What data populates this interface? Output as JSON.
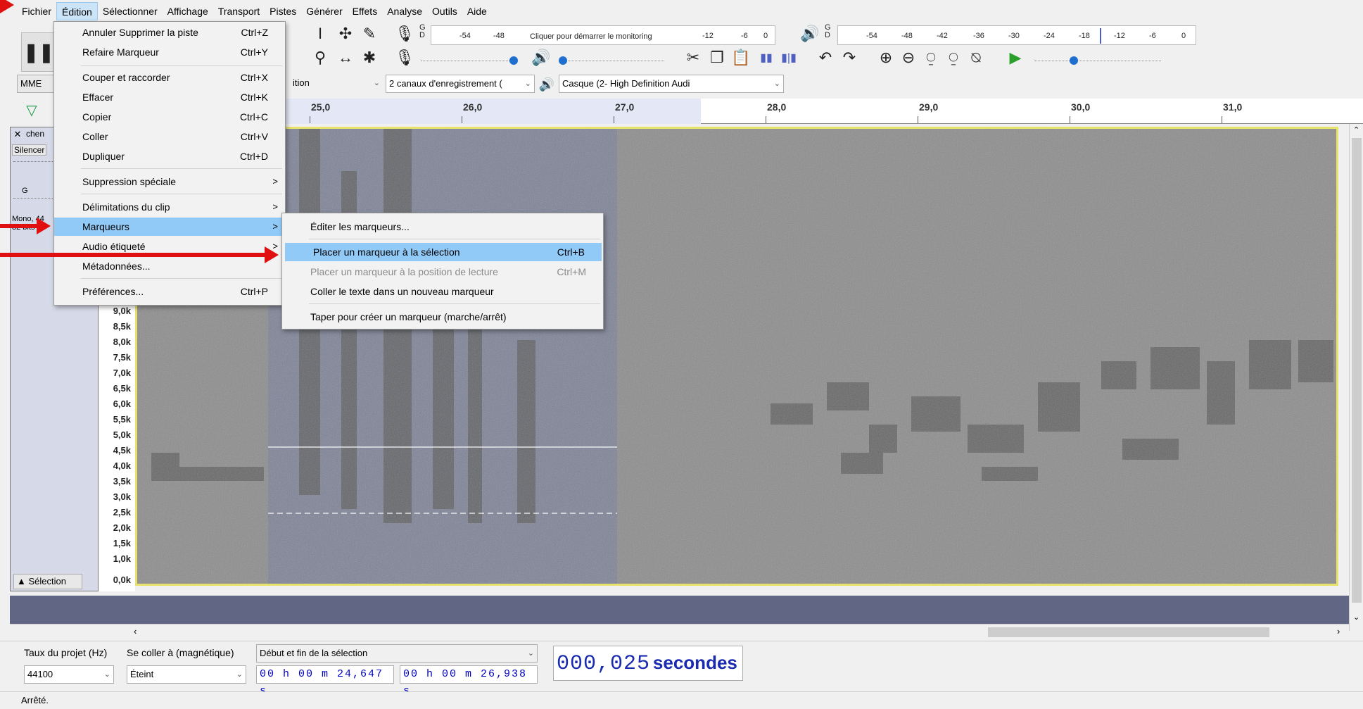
{
  "menubar": {
    "items": [
      "Fichier",
      "Édition",
      "Sélectionner",
      "Affichage",
      "Transport",
      "Pistes",
      "Générer",
      "Effets",
      "Analyse",
      "Outils",
      "Aide"
    ],
    "active": "Édition"
  },
  "toolbar": {
    "monitor_label": "Cliquer pour démarrer le monitoring",
    "rec_meter_scale": [
      "-54",
      "-48",
      "-12",
      "-6",
      "0"
    ],
    "play_meter_scale": [
      "-54",
      "-48",
      "-42",
      "-36",
      "-30",
      "-24",
      "-18",
      "-12",
      "-6",
      "0"
    ],
    "rec_channel": "G\nD",
    "host": "MME",
    "rec_device": "ition",
    "rec_channels": "2 canaux d'enregistrement (",
    "play_device": "Casque (2- High Definition Audi"
  },
  "ruler": {
    "labels": [
      "25,0",
      "26,0",
      "27,0",
      "28,0",
      "29,0",
      "30,0",
      "31,0"
    ]
  },
  "track": {
    "name": "chen",
    "silence_label": "Silencer",
    "gain_label": "G",
    "info": "Mono, 44",
    "info2": "32 bits fl",
    "select_label": "Sélection"
  },
  "freq_axis": [
    "9,0k",
    "8,5k",
    "8,0k",
    "7,5k",
    "7,0k",
    "6,5k",
    "6,0k",
    "5,5k",
    "5,0k",
    "4,5k",
    "4,0k",
    "3,5k",
    "3,0k",
    "2,5k",
    "2,0k",
    "1,5k",
    "1,0k",
    "0,0k"
  ],
  "edit_menu": {
    "items": [
      {
        "label": "Annuler Supprimer la piste",
        "shortcut": "Ctrl+Z"
      },
      {
        "label": "Refaire Marqueur",
        "shortcut": "Ctrl+Y"
      },
      {
        "label": "Couper et raccorder",
        "shortcut": "Ctrl+X"
      },
      {
        "label": "Effacer",
        "shortcut": "Ctrl+K"
      },
      {
        "label": "Copier",
        "shortcut": "Ctrl+C"
      },
      {
        "label": "Coller",
        "shortcut": "Ctrl+V"
      },
      {
        "label": "Dupliquer",
        "shortcut": "Ctrl+D"
      },
      {
        "label": "Suppression spéciale",
        "shortcut": ">"
      },
      {
        "label": "Délimitations du clip",
        "shortcut": ">"
      },
      {
        "label": "Marqueurs",
        "shortcut": ">"
      },
      {
        "label": "Audio étiqueté",
        "shortcut": ">"
      },
      {
        "label": "Métadonnées...",
        "shortcut": ""
      },
      {
        "label": "Préférences...",
        "shortcut": "Ctrl+P"
      }
    ]
  },
  "markers_menu": {
    "items": [
      {
        "label": "Éditer les marqueurs...",
        "shortcut": ""
      },
      {
        "label": "Placer un marqueur à la sélection",
        "shortcut": "Ctrl+B"
      },
      {
        "label": "Placer un marqueur à la position de lecture",
        "shortcut": "Ctrl+M"
      },
      {
        "label": "Coller le texte dans un nouveau marqueur",
        "shortcut": ""
      },
      {
        "label": "Taper pour créer un marqueur (marche/arrêt)",
        "shortcut": ""
      }
    ]
  },
  "selection_toolbar": {
    "rate_label": "Taux du projet (Hz)",
    "rate_value": "44100",
    "snap_label": "Se coller à (magnétique)",
    "snap_value": "Éteint",
    "mode_value": "Début et fin de la sélection",
    "start": "00 h 00 m 24,647 s",
    "end": "00 h 00 m 26,938 s",
    "length_value": "000,025",
    "length_unit": "secondes"
  },
  "status": "Arrêté.",
  "colors": {
    "menu_highlight": "#91c9f7",
    "selection_border": "#e7e26b",
    "arrow": "#e01010",
    "time_text": "#0000c0"
  }
}
